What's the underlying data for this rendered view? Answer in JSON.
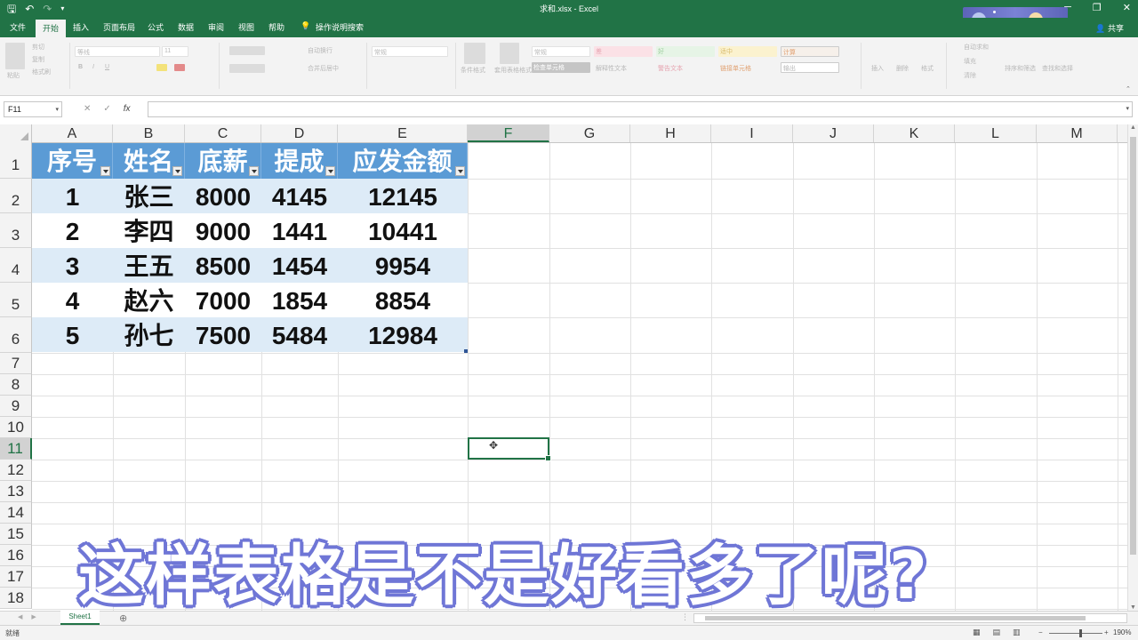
{
  "window": {
    "title": "求和.xlsx  -  Excel"
  },
  "qat": {
    "save_icon": "save-icon",
    "undo_icon": "undo-icon",
    "redo_icon": "redo-icon",
    "customize_icon": "customize-qat-icon"
  },
  "tabs": [
    {
      "label": "文件"
    },
    {
      "label": "开始"
    },
    {
      "label": "插入"
    },
    {
      "label": "页面布局"
    },
    {
      "label": "公式"
    },
    {
      "label": "数据"
    },
    {
      "label": "审阅"
    },
    {
      "label": "视图"
    },
    {
      "label": "帮助"
    }
  ],
  "tell_me": "操作说明搜索",
  "share": "共享",
  "ribbon": {
    "font_name": "等线",
    "font_size": "11",
    "wrap_text": "自动换行",
    "merge": "合并后居中",
    "number_format": "常规",
    "style_normal": "常规",
    "style_bad": "差",
    "style_good": "好",
    "style_neutral": "适中",
    "style_calc": "计算",
    "style_check": "检查单元格",
    "style_explain": "解释性文本",
    "style_warn": "警告文本",
    "style_link": "链接单元格",
    "style_output": "输出",
    "autosum": "自动求和",
    "fill": "填充",
    "clear": "清除",
    "sort_filter": "排序和筛选",
    "find_select": "查找和选择",
    "cut": "剪切",
    "copy": "复制",
    "format_painter": "格式刷",
    "paste": "粘贴",
    "cond_format": "条件格式",
    "table_format": "套用表格格式",
    "insert": "插入",
    "delete": "删除",
    "format": "格式"
  },
  "formula_bar": {
    "name_box": "F11",
    "cancel": "✕",
    "enter": "✓",
    "fx": "fx",
    "value": ""
  },
  "columns": [
    "A",
    "B",
    "C",
    "D",
    "E",
    "F",
    "G",
    "H",
    "I",
    "J",
    "K",
    "L",
    "M"
  ],
  "selected_column": "F",
  "rows": [
    "1",
    "2",
    "3",
    "4",
    "5",
    "6",
    "7",
    "8",
    "9",
    "10",
    "11",
    "12",
    "13",
    "14",
    "15",
    "16",
    "17",
    "18"
  ],
  "selected_row": "11",
  "table": {
    "headers": [
      "序号",
      "姓名",
      "底薪",
      "提成",
      "应发金额"
    ],
    "rows": [
      [
        "1",
        "张三",
        "8000",
        "4145",
        "12145"
      ],
      [
        "2",
        "李四",
        "9000",
        "1441",
        "10441"
      ],
      [
        "3",
        "王五",
        "8500",
        "1454",
        "9954"
      ],
      [
        "4",
        "赵六",
        "7000",
        "1854",
        "8854"
      ],
      [
        "5",
        "孙七",
        "7500",
        "5484",
        "12984"
      ]
    ],
    "header_color": "#5b9bd5",
    "band_color": "#ddebf7"
  },
  "caption": "这样表格是不是好看多了呢?",
  "sheets": [
    {
      "label": "Sheet1"
    }
  ],
  "status": {
    "ready": "就绪",
    "zoom": "190%"
  },
  "colors": {
    "excel_green": "#217346",
    "caption_outline": "#6f76d6"
  }
}
